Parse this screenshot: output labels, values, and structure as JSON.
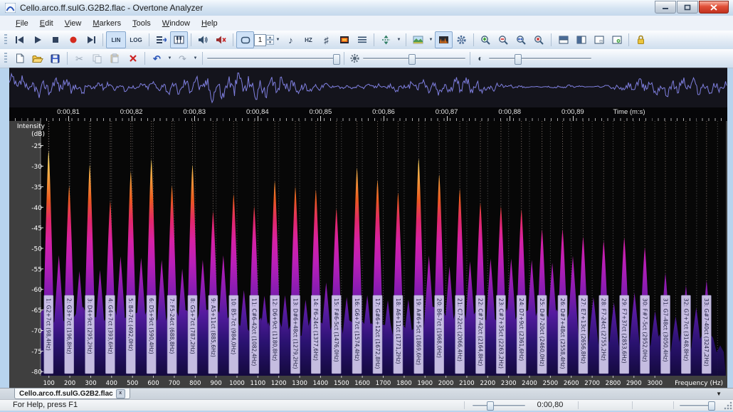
{
  "window": {
    "title": "Cello.arco.ff.sulG.G2B2.flac - Overtone Analyzer"
  },
  "menu": {
    "items": [
      "File",
      "Edit",
      "View",
      "Markers",
      "Tools",
      "Window",
      "Help"
    ]
  },
  "toolbar": {
    "lin_label": "LIN",
    "log_label": "LOG",
    "hz_label": "HZ",
    "loop_count": "1"
  },
  "icons": {
    "note": "♪",
    "sharp": "♯",
    "undo": "↶",
    "redo": "↷",
    "cut": "✂",
    "delete": "✕",
    "dropdown": "▼",
    "spin_up": "▲",
    "spin_down": "▼",
    "contrast": "◐",
    "tab_close": "x",
    "minimize": "—"
  },
  "sliders": {
    "playback_position_percent": 97,
    "brightness_percent": 48,
    "contrast_percent": 29,
    "status_time_percent": 34,
    "status_zoom_percent": 90
  },
  "time_ruler": {
    "ticks": [
      "0:00,81",
      "0:00,82",
      "0:00,83",
      "0:00,84",
      "0:00,85",
      "0:00,86",
      "0:00,87",
      "0:00,88",
      "0:00,89"
    ],
    "label": "Time (m:s)"
  },
  "chart_data": {
    "type": "area",
    "xlabel": "Frequency (Hz)",
    "ylabel": "Intensity (dB)",
    "ylabel_lines": [
      "Intensity",
      "(dB)"
    ],
    "xlim": [
      60,
      3340
    ],
    "ylim": [
      -81,
      -19
    ],
    "grid": true,
    "fundamental_hz": 98.4,
    "x_ticks": [
      100,
      200,
      300,
      400,
      500,
      600,
      700,
      800,
      900,
      1000,
      1100,
      1200,
      1300,
      1400,
      1500,
      1600,
      1700,
      1800,
      1900,
      2000,
      2100,
      2200,
      2300,
      2400,
      2500,
      2600,
      2700,
      2800,
      2900,
      3000
    ],
    "y_ticks": [
      -25,
      -30,
      -35,
      -40,
      -45,
      -50,
      -55,
      -60,
      -65,
      -70,
      -75,
      -80
    ],
    "peaks": [
      {
        "n": 1,
        "label": "1: G2+7ct (98,4Hz)",
        "freq_hz": 98.4,
        "peak_db": -26.2
      },
      {
        "n": 2,
        "label": "2: G3+7ct (196,8Hz)",
        "freq_hz": 196.8,
        "peak_db": -34.8
      },
      {
        "n": 3,
        "label": "3: D4+9ct (295,2Hz)",
        "freq_hz": 295.2,
        "peak_db": -29.6
      },
      {
        "n": 4,
        "label": "4: G4+7ct (393,6Hz)",
        "freq_hz": 393.6,
        "peak_db": -38.5
      },
      {
        "n": 5,
        "label": "5: B4-7ct (492,0Hz)",
        "freq_hz": 492.0,
        "peak_db": -31.3
      },
      {
        "n": 6,
        "label": "6: D5+9ct (590,4Hz)",
        "freq_hz": 590.4,
        "peak_db": -28.3
      },
      {
        "n": 7,
        "label": "7: F5-24ct (688,8Hz)",
        "freq_hz": 688.8,
        "peak_db": -34.7
      },
      {
        "n": 8,
        "label": "8: G5+7ct (787,2Hz)",
        "freq_hz": 787.2,
        "peak_db": -29.7
      },
      {
        "n": 9,
        "label": "9: A5+11ct (885,6Hz)",
        "freq_hz": 885.6,
        "peak_db": -41.0
      },
      {
        "n": 10,
        "label": "10: B5-7ct (984,0Hz)",
        "freq_hz": 984.0,
        "peak_db": -36.8
      },
      {
        "n": 11,
        "label": "11: C#6-42ct (1082,4Hz)",
        "freq_hz": 1082.4,
        "peak_db": -39.8
      },
      {
        "n": 12,
        "label": "12: D6+9ct (1180,8Hz)",
        "freq_hz": 1180.8,
        "peak_db": -33.6
      },
      {
        "n": 13,
        "label": "13: D#6+48ct (1279,2Hz)",
        "freq_hz": 1279.2,
        "peak_db": -35.0
      },
      {
        "n": 14,
        "label": "14: F6-24ct (1377,6Hz)",
        "freq_hz": 1377.6,
        "peak_db": -35.7
      },
      {
        "n": 15,
        "label": "15: F#6-5ct (1476,0Hz)",
        "freq_hz": 1476.0,
        "peak_db": -40.3
      },
      {
        "n": 16,
        "label": "16: G6+7ct (1574,4Hz)",
        "freq_hz": 1574.4,
        "peak_db": -30.4
      },
      {
        "n": 17,
        "label": "17: G#6+12ct (1672,8Hz)",
        "freq_hz": 1672.8,
        "peak_db": -33.3
      },
      {
        "n": 18,
        "label": "18: A6+11ct (1771,2Hz)",
        "freq_hz": 1771.2,
        "peak_db": -36.4
      },
      {
        "n": 19,
        "label": "19: A#6+5ct (1869,6Hz)",
        "freq_hz": 1869.6,
        "peak_db": -28.1
      },
      {
        "n": 20,
        "label": "20: B6-7ct (1968,0Hz)",
        "freq_hz": 1968.0,
        "peak_db": -32.0
      },
      {
        "n": 21,
        "label": "21: C7-22ct (2066,4Hz)",
        "freq_hz": 2066.4,
        "peak_db": -35.5
      },
      {
        "n": 22,
        "label": "22: C#7-42ct (2164,8Hz)",
        "freq_hz": 2164.8,
        "peak_db": -38.9
      },
      {
        "n": 23,
        "label": "23: C#7+35ct (2263,2Hz)",
        "freq_hz": 2263.2,
        "peak_db": -39.8
      },
      {
        "n": 24,
        "label": "24: D7+9ct (2361,6Hz)",
        "freq_hz": 2361.6,
        "peak_db": -40.5
      },
      {
        "n": 25,
        "label": "25: D#7-20ct (2460,0Hz)",
        "freq_hz": 2460.0,
        "peak_db": -45.4
      },
      {
        "n": 26,
        "label": "26: D#7+48ct (2558,4Hz)",
        "freq_hz": 2558.4,
        "peak_db": -45.4
      },
      {
        "n": 27,
        "label": "27: E7+13ct (2656,8Hz)",
        "freq_hz": 2656.8,
        "peak_db": -47.2
      },
      {
        "n": 28,
        "label": "28: F7-24ct (2755,2Hz)",
        "freq_hz": 2755.2,
        "peak_db": -48.2
      },
      {
        "n": 29,
        "label": "29: F7+37ct (2853,6Hz)",
        "freq_hz": 2853.6,
        "peak_db": -47.4
      },
      {
        "n": 30,
        "label": "30: F#7-5ct (2952,0Hz)",
        "freq_hz": 2952.0,
        "peak_db": -49.8
      },
      {
        "n": 31,
        "label": "31: G7-48ct (3050,4Hz)",
        "freq_hz": 3050.4,
        "peak_db": -56.1
      },
      {
        "n": 32,
        "label": "32: G7+7ct (3148,8Hz)",
        "freq_hz": 3148.8,
        "peak_db": -59.1
      },
      {
        "n": 33,
        "label": "33: G#7-40ct (3247,2Hz)",
        "freq_hz": 3247.2,
        "peak_db": -57.9
      }
    ]
  },
  "document_tab": {
    "label": "Cello.arco.ff.sulG.G2B2.flac"
  },
  "status": {
    "help": "For Help, press F1",
    "time": "0:00,80"
  }
}
